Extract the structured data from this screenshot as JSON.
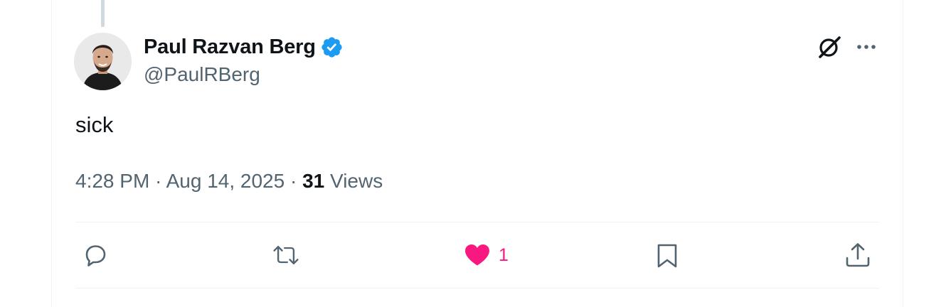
{
  "tweet": {
    "author": {
      "display_name": "Paul Razvan Berg",
      "handle": "@PaulRBerg",
      "verified": true
    },
    "text": "sick",
    "timestamp": "4:28 PM · Aug 14, 2025",
    "separator": " · ",
    "views_count": "31",
    "views_label": " Views"
  },
  "actions": {
    "reply_icon": "reply-icon",
    "retweet_icon": "retweet-icon",
    "like_icon": "heart-filled-icon",
    "like_count": "1",
    "bookmark_icon": "bookmark-icon",
    "share_icon": "share-icon"
  },
  "colors": {
    "verified_blue": "#1d9bf0",
    "like_pink": "#f91880",
    "secondary_text": "#536471",
    "primary_text": "#0f1419"
  }
}
